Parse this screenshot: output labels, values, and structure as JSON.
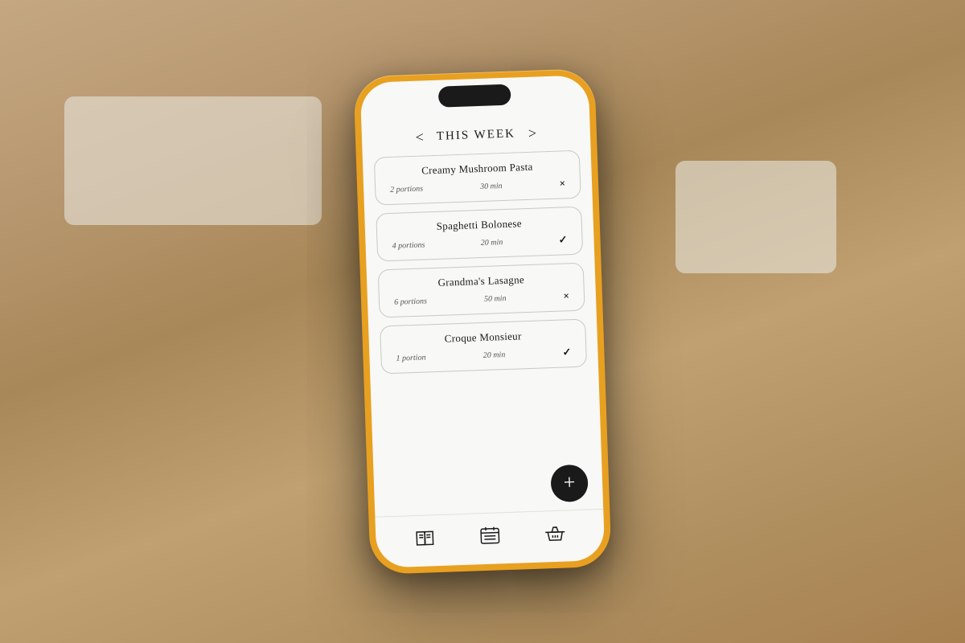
{
  "background": {
    "color": "#a08060"
  },
  "phone": {
    "shell_color": "#e8a020"
  },
  "header": {
    "title": "This Week",
    "prev_label": "<",
    "next_label": ">"
  },
  "recipes": [
    {
      "name": "Creamy Mushroom Pasta",
      "portions": "2 portions",
      "time": "30 min",
      "action": "×",
      "action_type": "remove"
    },
    {
      "name": "Spaghetti Bolonese",
      "portions": "4 portions",
      "time": "20 min",
      "action": "✓",
      "action_type": "check"
    },
    {
      "name": "Grandma's Lasagne",
      "portions": "6 portions",
      "time": "50 min",
      "action": "×",
      "action_type": "remove"
    },
    {
      "name": "Croque Monsieur",
      "portions": "1 portion",
      "time": "20 min",
      "action": "✓",
      "action_type": "check"
    }
  ],
  "fab": {
    "label": "+"
  },
  "nav": {
    "items": [
      {
        "name": "recipes",
        "icon": "book"
      },
      {
        "name": "week",
        "icon": "calendar"
      },
      {
        "name": "shopping",
        "icon": "basket"
      }
    ]
  }
}
